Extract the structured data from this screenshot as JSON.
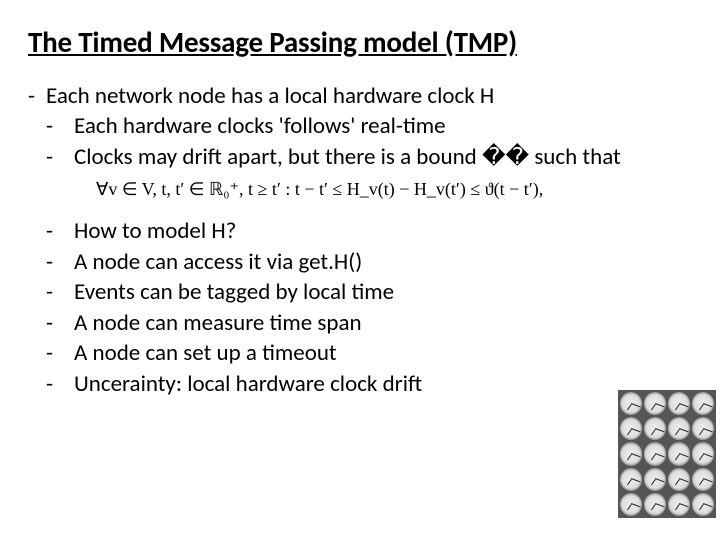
{
  "title": "The Timed Message Passing model (TMP)",
  "intro": "Each network node has a local hardware clock H",
  "sub1": [
    "Each hardware clocks 'follows' real-time",
    "Clocks may drift apart, but there is a bound �� such that"
  ],
  "formula": "∀v ∈ V, t, t′ ∈ ℝ₀⁺, t ≥ t′ : t − t′ ≤ H_v(t) − H_v(t′) ≤ ϑ(t − t′),",
  "sub2": [
    "How to model H?",
    "A node can access it via get.H()",
    "Events can be tagged by local time",
    "A node can measure time span",
    "A node can set up a timeout",
    "Uncerainty: local hardware clock drift"
  ]
}
